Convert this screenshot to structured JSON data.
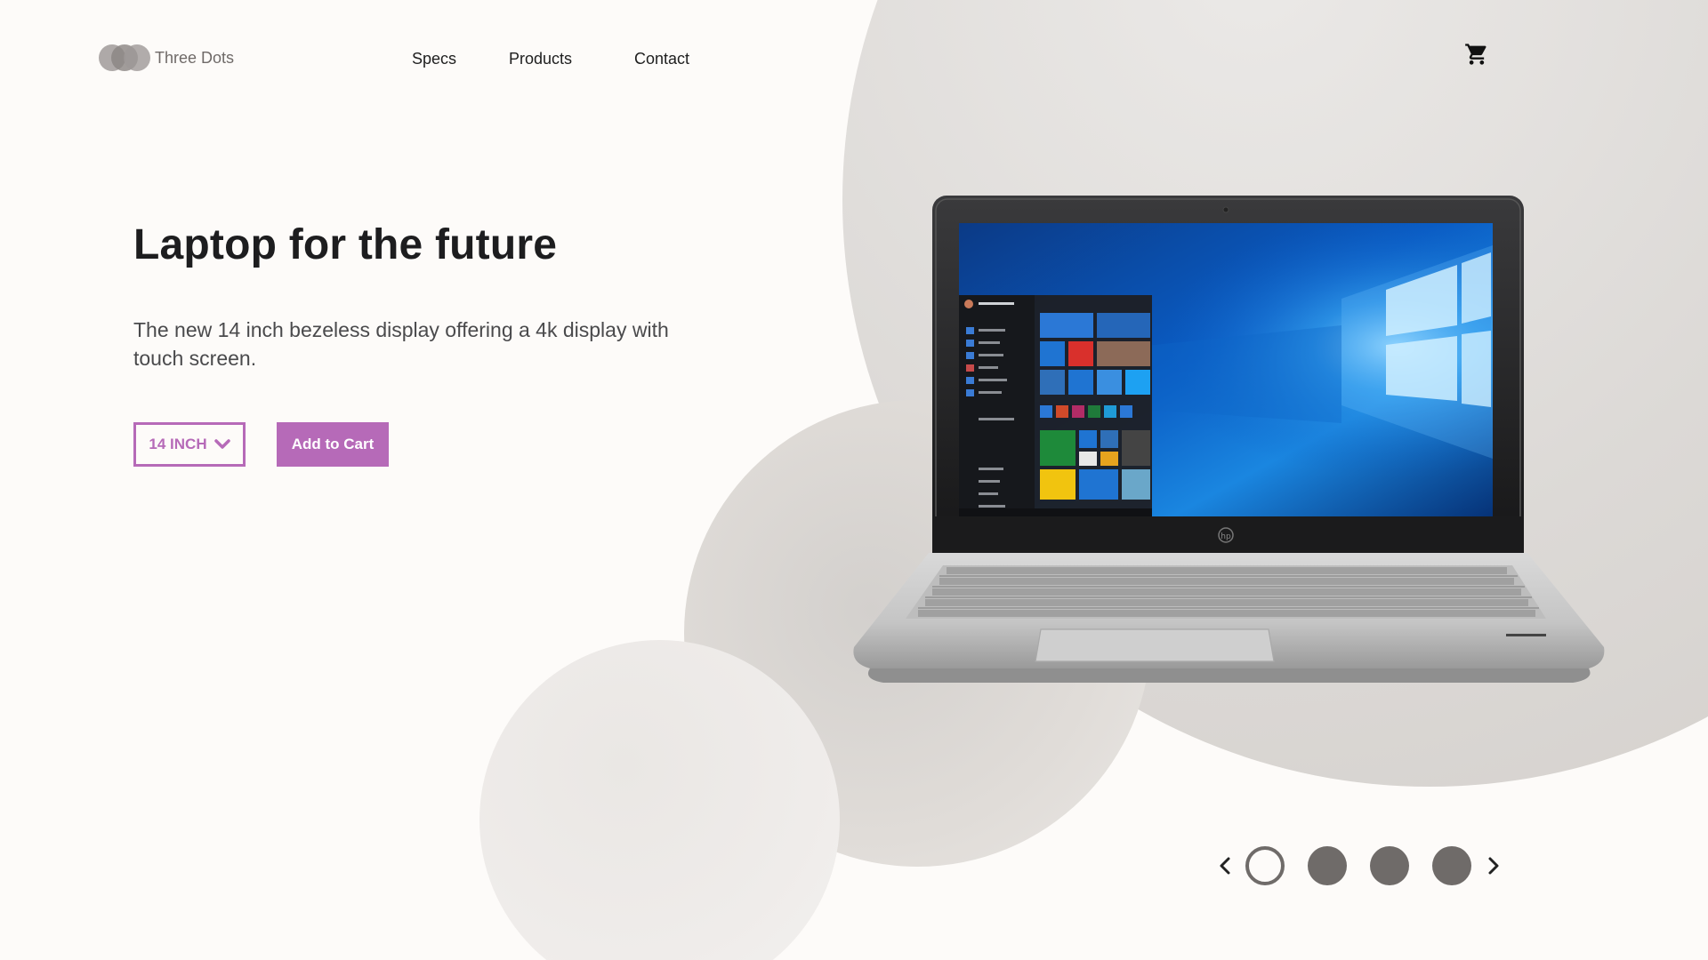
{
  "brand": {
    "name": "Three Dots",
    "logo_icon": "three-dots-logo-icon"
  },
  "nav": {
    "items": [
      {
        "label": "Specs"
      },
      {
        "label": "Products"
      },
      {
        "label": "Contact"
      }
    ],
    "cart_icon": "cart-icon"
  },
  "hero": {
    "title": "Laptop for the future",
    "description": "The new 14 inch bezeless display offering a 4k display with touch screen.",
    "size_select": {
      "value": "14 INCH",
      "icon": "chevron-down-icon"
    },
    "add_to_cart_label": "Add to Cart",
    "product_image": "laptop-product-image"
  },
  "carousel": {
    "slide_count": 4,
    "active_index": 0,
    "prev_icon": "chevron-left-icon",
    "next_icon": "chevron-right-icon"
  },
  "colors": {
    "background": "#fdfbf9",
    "accent": "#b66ab8",
    "circle": "#dcd9d6",
    "carousel_dot": "#6f6b69",
    "text_dark": "#1d1d1f",
    "text_body": "#4a4a4c"
  }
}
